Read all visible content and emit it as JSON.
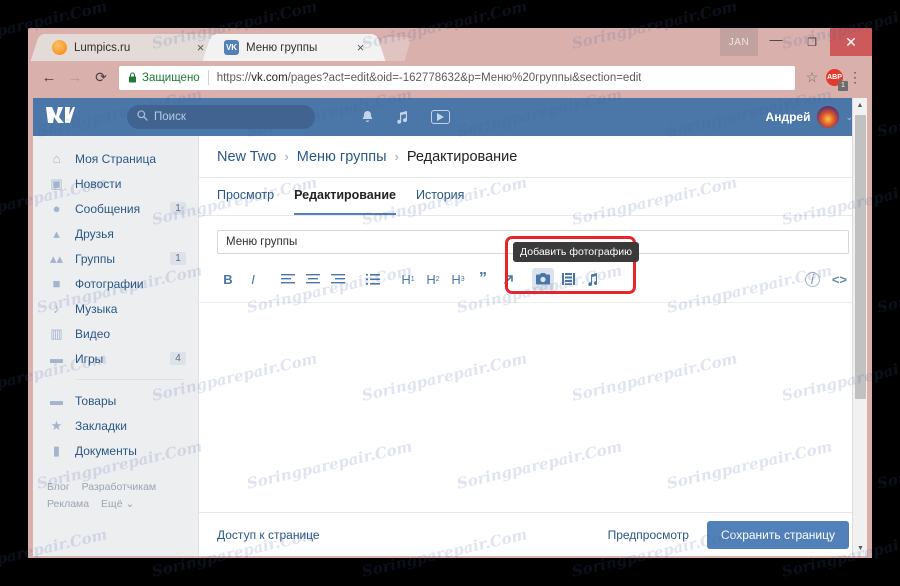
{
  "browser": {
    "tabs": [
      {
        "title": "Lumpics.ru",
        "favicon": "orange-circle-icon",
        "close": "×"
      },
      {
        "title": "Меню группы",
        "favicon": "vk-icon",
        "favicon_text": "VK",
        "close": "×"
      }
    ],
    "window_controls": {
      "jan_label": "JAN",
      "minimize": "—",
      "maximize": "❐",
      "close": "✕"
    },
    "nav": {
      "back": "←",
      "forward": "→",
      "reload": "⟳"
    },
    "omnibox": {
      "secure_label": "Защищено",
      "url_scheme": "https://",
      "url_host": "vk.com",
      "url_path": "/pages?act=edit&oid=-162778632&p=Меню%20группы&section=edit",
      "star": "☆",
      "adblock_label": "ABP",
      "adblock_badge": "1",
      "menu": "⋮"
    }
  },
  "vk_header": {
    "logo": "ВК",
    "search_placeholder": "Поиск",
    "search_icon": "search-icon",
    "icons": [
      {
        "name": "bell-icon",
        "glyph": "🔔"
      },
      {
        "name": "music-note-icon",
        "glyph": "♫"
      },
      {
        "name": "video-play-icon",
        "glyph": "▶"
      }
    ],
    "username": "Андрей",
    "chevron": "⌄"
  },
  "sidebar": {
    "items": [
      {
        "label": "Моя Страница",
        "icon": "home-icon",
        "glyph": "⌂",
        "badge": ""
      },
      {
        "label": "Новости",
        "icon": "news-icon",
        "glyph": "▣",
        "badge": ""
      },
      {
        "label": "Сообщения",
        "icon": "message-icon",
        "glyph": "●",
        "badge": "1"
      },
      {
        "label": "Друзья",
        "icon": "friend-icon",
        "glyph": "▴",
        "badge": ""
      },
      {
        "label": "Группы",
        "icon": "groups-icon",
        "glyph": "▴▴",
        "badge": "1"
      },
      {
        "label": "Фотографии",
        "icon": "camera-icon",
        "glyph": "■",
        "badge": ""
      },
      {
        "label": "Музыка",
        "icon": "music-icon",
        "glyph": "♪",
        "badge": ""
      },
      {
        "label": "Видео",
        "icon": "video-icon",
        "glyph": "▥",
        "badge": ""
      },
      {
        "label": "Игры",
        "icon": "gamepad-icon",
        "glyph": "▬",
        "badge": "4"
      }
    ],
    "items2": [
      {
        "label": "Товары",
        "icon": "bag-icon",
        "glyph": "▬",
        "badge": ""
      },
      {
        "label": "Закладки",
        "icon": "star-icon",
        "glyph": "★",
        "badge": ""
      },
      {
        "label": "Документы",
        "icon": "document-icon",
        "glyph": "▮",
        "badge": ""
      }
    ],
    "footer": {
      "blog": "Блог",
      "devs": "Разработчикам",
      "ads": "Реклама",
      "more": "Ещё ⌄"
    }
  },
  "main": {
    "breadcrumb": {
      "root": "New Two",
      "sep": "›",
      "page": "Меню группы",
      "current": "Редактирование"
    },
    "tabs": [
      {
        "label": "Просмотр",
        "active": false
      },
      {
        "label": "Редактирование",
        "active": true
      },
      {
        "label": "История",
        "active": false
      }
    ],
    "title_input_value": "Меню группы",
    "toolbar": {
      "bold": "B",
      "italic": "I",
      "align_left": "≡",
      "align_center": "≡",
      "align_right": "≡",
      "list": "☰",
      "h1": "H",
      "h1_sub": "1",
      "h2": "H",
      "h2_sub": "2",
      "h3": "H",
      "h3_sub": "3",
      "quote": "”",
      "anchor": "↗",
      "photo": "◉",
      "video": "▒",
      "music": "♫",
      "info": "i",
      "code": "<>"
    },
    "tooltip": "Добавить фотографию",
    "bottom": {
      "access": "Доступ к странице",
      "preview": "Предпросмотр",
      "save": "Сохранить страницу"
    }
  },
  "scrollbar": {
    "up": "▲",
    "down": "▼"
  },
  "watermark": {
    "text": "Soringparepair.Com"
  },
  "colors": {
    "vk_blue": "#4a76a8",
    "accent_button": "#5181b8",
    "link": "#2a5885",
    "highlight_red": "#e8262a",
    "chrome": "#d9b0ac",
    "close_red": "#cc5a5a"
  }
}
